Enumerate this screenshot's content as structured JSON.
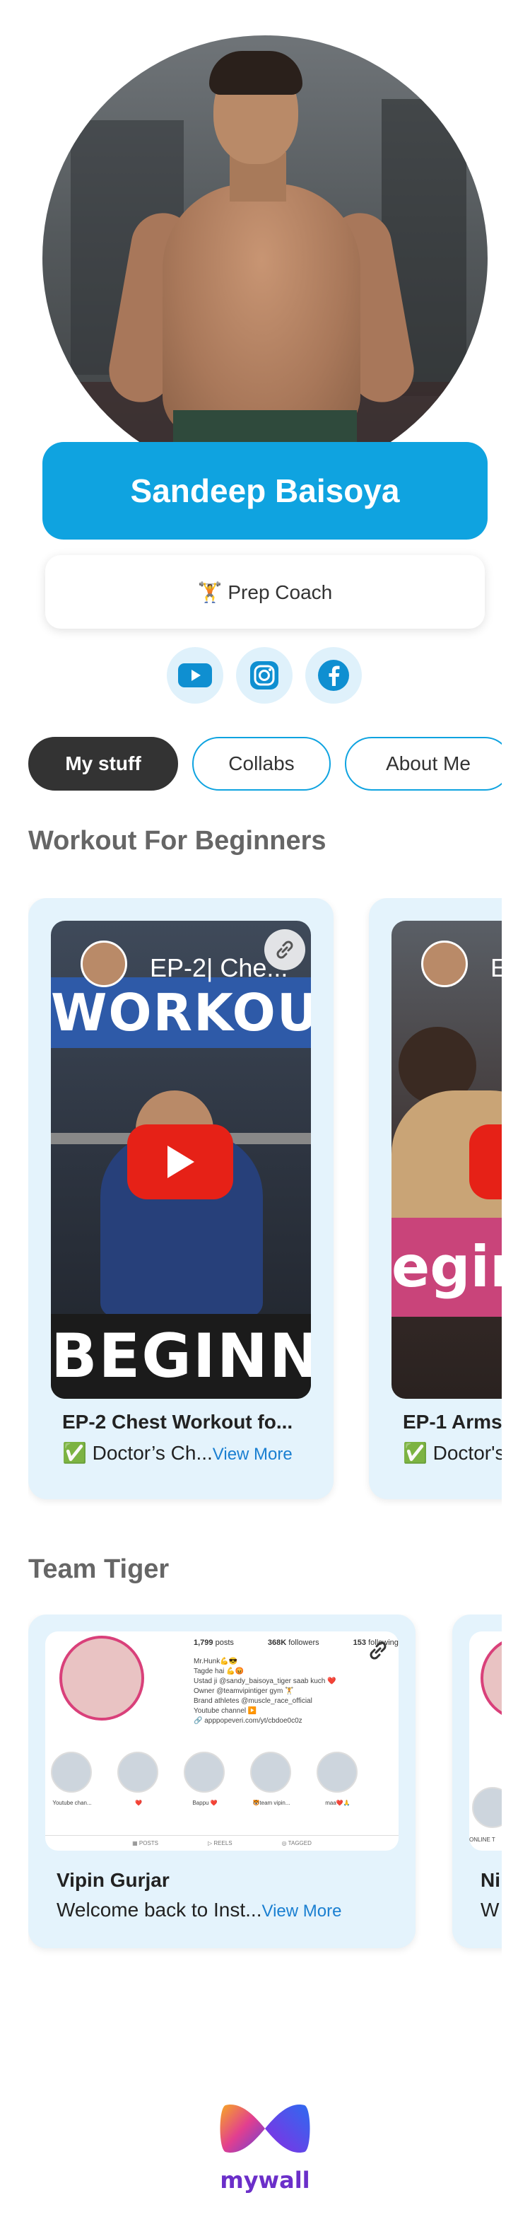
{
  "profile": {
    "name": "Sandeep Baisoya",
    "bio": "🏋️ Prep Coach"
  },
  "socials": [
    {
      "icon": "youtube-icon"
    },
    {
      "icon": "instagram-icon"
    },
    {
      "icon": "facebook-icon"
    }
  ],
  "tabs": [
    {
      "label": "My stuff",
      "active": true
    },
    {
      "label": "Collabs",
      "active": false
    },
    {
      "label": "About Me",
      "active": false
    }
  ],
  "sections": {
    "workout": {
      "title": "Workout For Beginners",
      "cards": [
        {
          "thumb_title": "EP-2| Che...",
          "thumb_banner": "WORKOUT",
          "thumb_bottom": "BEGINN",
          "title": "EP-2 Chest Workout fo...",
          "desc": "✅ Doctor’s Ch...",
          "view_more": "View More"
        },
        {
          "thumb_title": "E",
          "thumb_pink": "eginn",
          "title": "EP-1 Arms",
          "desc": "✅ Doctor's"
        }
      ]
    },
    "team": {
      "title": "Team Tiger",
      "cards": [
        {
          "title": "Vipin Gurjar",
          "desc": "Welcome back to Inst...",
          "view_more": "View More",
          "insta": {
            "posts": "1,799",
            "posts_label": "posts",
            "followers": "368K",
            "followers_label": "followers",
            "following": "153",
            "following_label": "following",
            "bio_lines": [
              "Mr.Hunk💪😎",
              "Tagde hai 💪😡",
              "Ustad ji @sandy_baisoya_tiger saab kuch ❤️",
              "Owner @teamvipintiger gym 🏋️",
              "Brand athletes @muscle_race_official",
              "Youtube channel ▶️",
              "🔗 apppopeveri.com/yt/cbdoe0c0z"
            ],
            "highlights": [
              "Youtube chan...",
              "❤️",
              "Bappu ❤️",
              "🐯team vipin...",
              "maa❤️🙏"
            ],
            "tab_posts": "▦ POSTS",
            "tab_reels": "▷ REELS",
            "tab_tagged": "◎ TAGGED"
          }
        },
        {
          "title": "Ni",
          "desc": "W",
          "insta_label": "ONLINE T"
        }
      ]
    }
  },
  "footer": {
    "brand": "mywall"
  }
}
